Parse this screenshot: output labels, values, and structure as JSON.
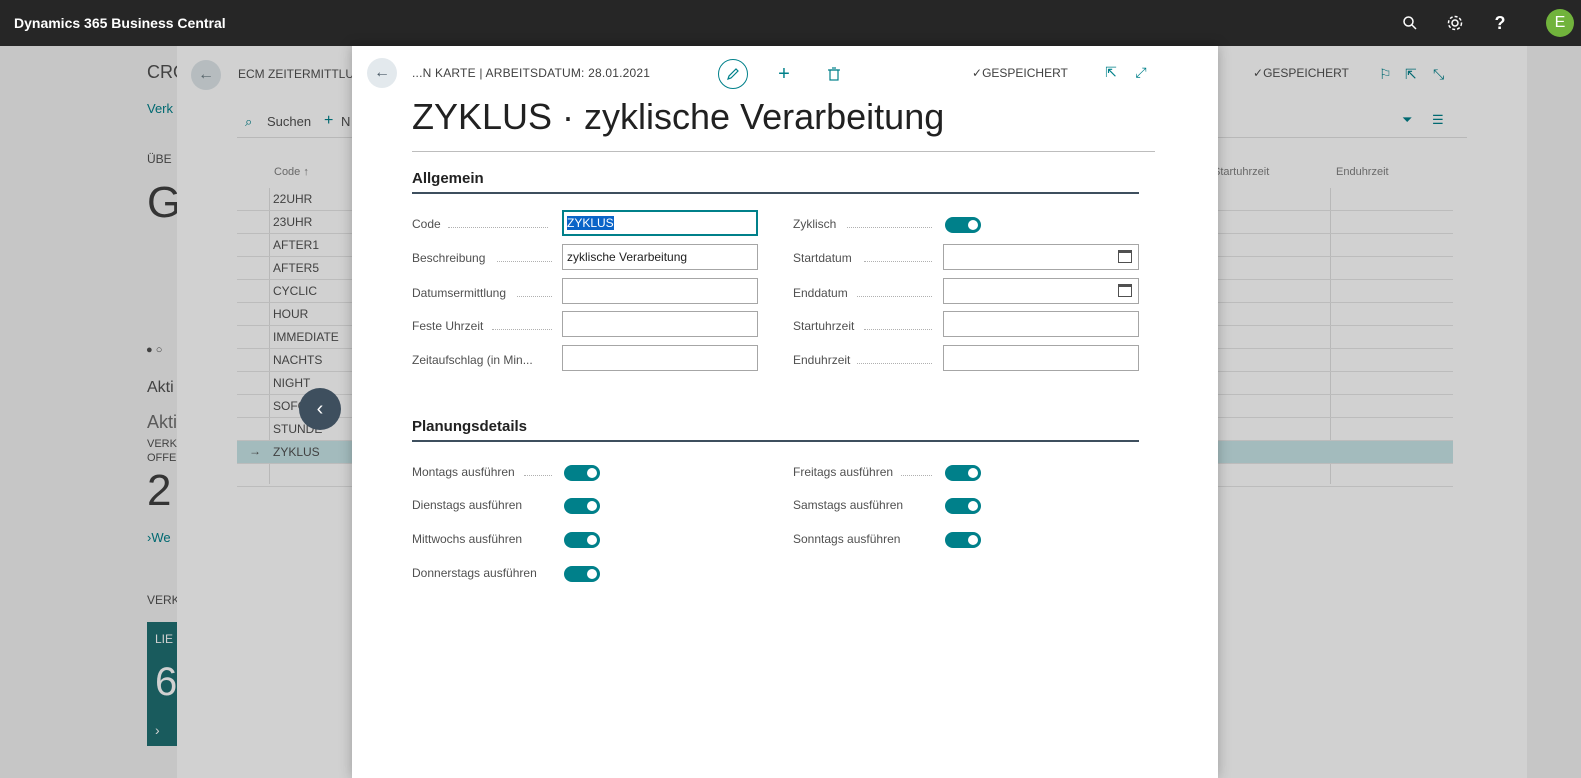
{
  "appbar": {
    "title": "Dynamics 365 Business Central",
    "user_initial": "E"
  },
  "role_center": {
    "header_fragment": "CRO",
    "link_fragment": "Verk",
    "section_fragment": "ÜBE",
    "big_fragment": "G",
    "activities_fragment": "Akti",
    "activities_sub_fragment": "Akti",
    "cue_label_1": "VERK",
    "cue_label_2": "OFFE",
    "cue_value": "2",
    "link2_fragment": "We",
    "section2_fragment": "VERK",
    "tile_label": "LIE",
    "tile_value": "6"
  },
  "list_page": {
    "title": "ECM ZEITERMITTLUN",
    "saved": "GESPEICHERT",
    "search_label": "Suchen",
    "new_label": "N",
    "col_code": "Code ↑",
    "col_start": "Startuhrzeit",
    "col_end": "Enduhrzeit",
    "rows": [
      "22UHR",
      "23UHR",
      "AFTER1",
      "AFTER5",
      "CYCLIC",
      "HOUR",
      "IMMEDIATE",
      "NACHTS",
      "NIGHT",
      "SOFO",
      "STUNDE",
      "ZYKLUS",
      ""
    ]
  },
  "card": {
    "breadcrumb": "...N KARTE | ARBEITSDATUM: 28.01.2021",
    "saved_label": "GESPEICHERT",
    "title": "ZYKLUS · zyklische Verarbeitung",
    "general": {
      "heading": "Allgemein",
      "code_label": "Code",
      "code_value": "ZYKLUS",
      "description_label": "Beschreibung",
      "description_value": "zyklische Verarbeitung",
      "date_calc_label": "Datumsermittlung",
      "date_calc_value": "",
      "fixed_time_label": "Feste Uhrzeit",
      "fixed_time_value": "",
      "time_surcharge_label": "Zeitaufschlag (in Min...",
      "time_surcharge_value": "",
      "cyclic_label": "Zyklisch",
      "cyclic_on": true,
      "start_date_label": "Startdatum",
      "start_date_value": "",
      "end_date_label": "Enddatum",
      "end_date_value": "",
      "start_time_label": "Startuhrzeit",
      "start_time_value": "",
      "end_time_label": "Enduhrzeit",
      "end_time_value": ""
    },
    "planning": {
      "heading": "Planungsdetails",
      "monday_label": "Montags ausführen",
      "tuesday_label": "Dienstags ausführen",
      "wednesday_label": "Mittwochs ausführen",
      "thursday_label": "Donnerstags ausführen",
      "friday_label": "Freitags ausführen",
      "saturday_label": "Samstags ausführen",
      "sunday_label": "Sonntags ausführen",
      "all_on": true
    }
  },
  "icons": {
    "search": "search-icon",
    "settings": "gear-icon",
    "help": "help-icon",
    "back": "arrow-left-icon",
    "edit": "pencil-icon",
    "add": "plus-icon",
    "delete": "trash-icon",
    "share": "share-icon",
    "expand": "expand-icon",
    "calendar": "calendar-icon"
  },
  "colors": {
    "appbar": "#262626",
    "accent": "#00808a",
    "avatar": "#71b33c",
    "selected_row": "#c7e4e7"
  }
}
